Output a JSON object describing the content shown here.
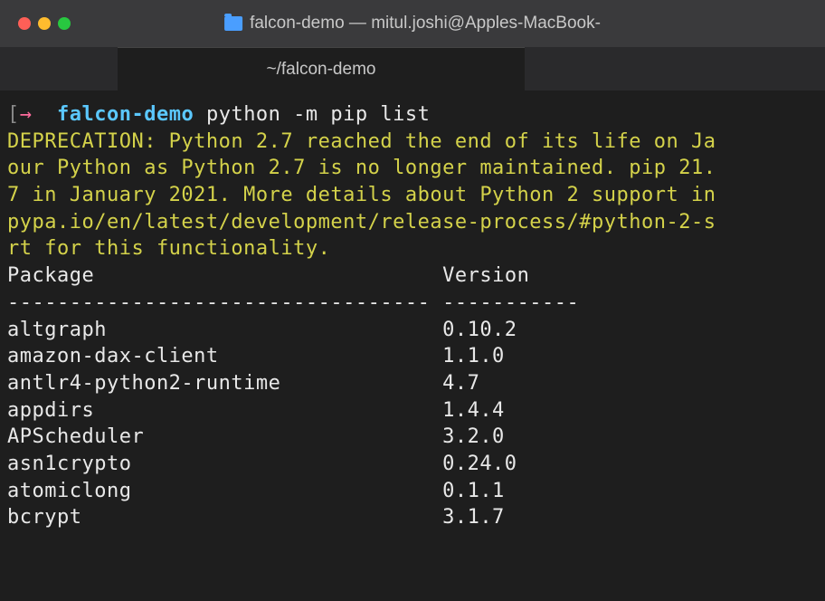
{
  "window": {
    "title_prefix": "falcon-demo —",
    "title_suffix": "mitul.joshi@Apples-MacBook-"
  },
  "tab": {
    "label": "~/falcon-demo"
  },
  "prompt": {
    "bracket": "[",
    "arrow": "→",
    "directory": "falcon-demo",
    "command": "python -m pip list"
  },
  "deprecation_lines": [
    "DEPRECATION: Python 2.7 reached the end of its life on Ja",
    "our Python as Python 2.7 is no longer maintained. pip 21.",
    "7 in January 2021. More details about Python 2 support in",
    "pypa.io/en/latest/development/release-process/#python-2-s",
    "rt for this functionality."
  ],
  "table": {
    "header_package": "Package",
    "header_version": "Version",
    "sep_package": "----------------------------------",
    "sep_version": "-----------",
    "rows": [
      {
        "package": "altgraph",
        "version": "0.10.2"
      },
      {
        "package": "amazon-dax-client",
        "version": "1.1.0"
      },
      {
        "package": "antlr4-python2-runtime",
        "version": "4.7"
      },
      {
        "package": "appdirs",
        "version": "1.4.4"
      },
      {
        "package": "APScheduler",
        "version": "3.2.0"
      },
      {
        "package": "asn1crypto",
        "version": "0.24.0"
      },
      {
        "package": "atomiclong",
        "version": "0.1.1"
      },
      {
        "package": "bcrypt",
        "version": "3.1.7"
      }
    ]
  }
}
